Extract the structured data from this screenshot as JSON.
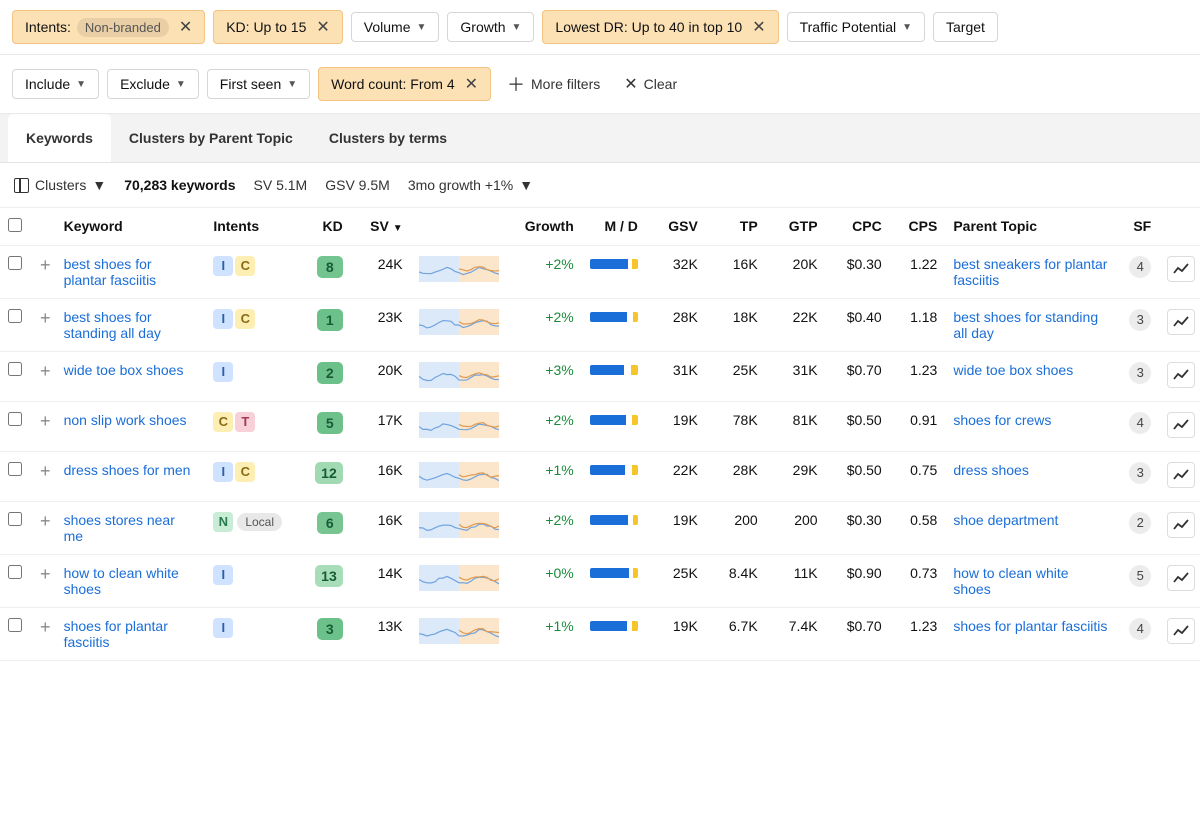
{
  "filters": {
    "row1": [
      {
        "label": "Intents:",
        "tag": "Non-branded",
        "active": true,
        "close": true
      },
      {
        "label": "KD: Up to 15",
        "active": true,
        "close": true
      },
      {
        "label": "Volume",
        "caret": true
      },
      {
        "label": "Growth",
        "caret": true
      },
      {
        "label": "Lowest DR: Up to 40 in top 10",
        "active": true,
        "close": true
      },
      {
        "label": "Traffic Potential",
        "caret": true
      },
      {
        "label": "Target"
      }
    ],
    "row2": [
      {
        "label": "Include",
        "caret": true
      },
      {
        "label": "Exclude",
        "caret": true
      },
      {
        "label": "First seen",
        "caret": true
      },
      {
        "label": "Word count: From 4",
        "active": true,
        "close": true
      }
    ],
    "moreFilters": "More filters",
    "clear": "Clear"
  },
  "tabs": [
    {
      "label": "Keywords",
      "active": true
    },
    {
      "label": "Clusters by Parent Topic"
    },
    {
      "label": "Clusters by terms"
    }
  ],
  "summary": {
    "clusters": "Clusters",
    "count": "70,283 keywords",
    "sv": "SV 5.1M",
    "gsv": "GSV 9.5M",
    "growth": "3mo growth +1%"
  },
  "columns": {
    "keyword": "Keyword",
    "intents": "Intents",
    "kd": "KD",
    "sv": "SV",
    "growth": "Growth",
    "md": "M / D",
    "gsv": "GSV",
    "tp": "TP",
    "gtp": "GTP",
    "cpc": "CPC",
    "cps": "CPS",
    "parent": "Parent Topic",
    "sf": "SF"
  },
  "rows": [
    {
      "keyword": "best shoes for plantar fasciitis",
      "intents": [
        "I",
        "C"
      ],
      "kd": 8,
      "kdColor": "#73c48f",
      "sv": "24K",
      "growth": "+2%",
      "mdBlue": 80,
      "mdYellow": 12,
      "gsv": "32K",
      "tp": "16K",
      "gtp": "20K",
      "cpc": "$0.30",
      "cps": "1.22",
      "parent": "best sneakers for plantar fasciitis",
      "sf": 4
    },
    {
      "keyword": "best shoes for standing all day",
      "intents": [
        "I",
        "C"
      ],
      "kd": 1,
      "kdColor": "#6cc089",
      "sv": "23K",
      "growth": "+2%",
      "mdBlue": 78,
      "mdYellow": 10,
      "gsv": "28K",
      "tp": "18K",
      "gtp": "22K",
      "cpc": "$0.40",
      "cps": "1.18",
      "parent": "best shoes for standing all day",
      "sf": 3
    },
    {
      "keyword": "wide toe box shoes",
      "intents": [
        "I"
      ],
      "kd": 2,
      "kdColor": "#6cc089",
      "sv": "20K",
      "growth": "+3%",
      "mdBlue": 72,
      "mdYellow": 14,
      "gsv": "31K",
      "tp": "25K",
      "gtp": "31K",
      "cpc": "$0.70",
      "cps": "1.23",
      "parent": "wide toe box shoes",
      "sf": 3
    },
    {
      "keyword": "non slip work shoes",
      "intents": [
        "C",
        "T"
      ],
      "kd": 5,
      "kdColor": "#6fc18b",
      "sv": "17K",
      "growth": "+2%",
      "mdBlue": 76,
      "mdYellow": 12,
      "gsv": "19K",
      "tp": "78K",
      "gtp": "81K",
      "cpc": "$0.50",
      "cps": "0.91",
      "parent": "shoes for crews",
      "sf": 4
    },
    {
      "keyword": "dress shoes for men",
      "intents": [
        "I",
        "C"
      ],
      "kd": 12,
      "kdColor": "#a0d9b2",
      "sv": "16K",
      "growth": "+1%",
      "mdBlue": 74,
      "mdYellow": 12,
      "gsv": "22K",
      "tp": "28K",
      "gtp": "29K",
      "cpc": "$0.50",
      "cps": "0.75",
      "parent": "dress shoes",
      "sf": 3
    },
    {
      "keyword": "shoes stores near me",
      "intents": [
        "N"
      ],
      "local": "Local",
      "kd": 6,
      "kdColor": "#78c592",
      "sv": "16K",
      "growth": "+2%",
      "mdBlue": 80,
      "mdYellow": 10,
      "gsv": "19K",
      "tp": "200",
      "gtp": "200",
      "cpc": "$0.30",
      "cps": "0.58",
      "parent": "shoe department",
      "sf": 2
    },
    {
      "keyword": "how to clean white shoes",
      "intents": [
        "I"
      ],
      "kd": 13,
      "kdColor": "#a8ddba",
      "sv": "14K",
      "growth": "+0%",
      "mdBlue": 82,
      "mdYellow": 10,
      "gsv": "25K",
      "tp": "8.4K",
      "gtp": "11K",
      "cpc": "$0.90",
      "cps": "0.73",
      "parent": "how to clean white shoes",
      "sf": 5
    },
    {
      "keyword": "shoes for plantar fasciitis",
      "intents": [
        "I"
      ],
      "kd": 3,
      "kdColor": "#6cc089",
      "sv": "13K",
      "growth": "+1%",
      "mdBlue": 78,
      "mdYellow": 12,
      "gsv": "19K",
      "tp": "6.7K",
      "gtp": "7.4K",
      "cpc": "$0.70",
      "cps": "1.23",
      "parent": "shoes for plantar fasciitis",
      "sf": 4
    }
  ]
}
